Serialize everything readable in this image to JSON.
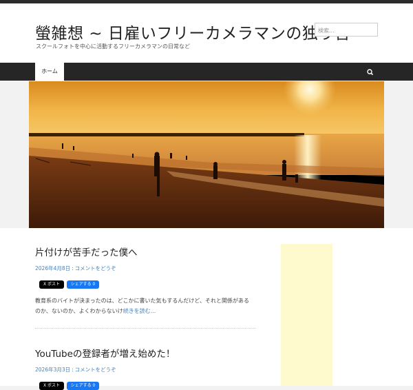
{
  "site": {
    "title": "螢雑想 ~ 日雇いフリーカメラマンの独り言",
    "description": "スクールフォトを中心に活動するフリーカメラマンの日常など"
  },
  "search": {
    "placeholder": "検索..."
  },
  "nav": {
    "home_label": "ホーム",
    "search_icon": "search-icon"
  },
  "posts": [
    {
      "title": "片付けが苦手だった僕へ",
      "date": "2026年4月8日",
      "separator": ":",
      "comment": "コメントをどうぞ",
      "share_x": "X ポスト",
      "share_fb": "シェアする 0",
      "excerpt": "教育系のバイトが決まったのは、どこかに書いた気もするんだけど、それと関係があるのか、ないのか、よくわからないけ",
      "more": "続きを読む..."
    },
    {
      "title": "YouTubeの登録者が増え始めた！",
      "date": "2026年3月3日",
      "separator": ":",
      "comment": "コメントをどうぞ",
      "share_x": "X ポスト",
      "share_fb": "シェアする 0"
    }
  ],
  "colors": {
    "link": "#4a7fb5",
    "nav_bg": "#262626",
    "ad_bg": "#fffacd"
  }
}
